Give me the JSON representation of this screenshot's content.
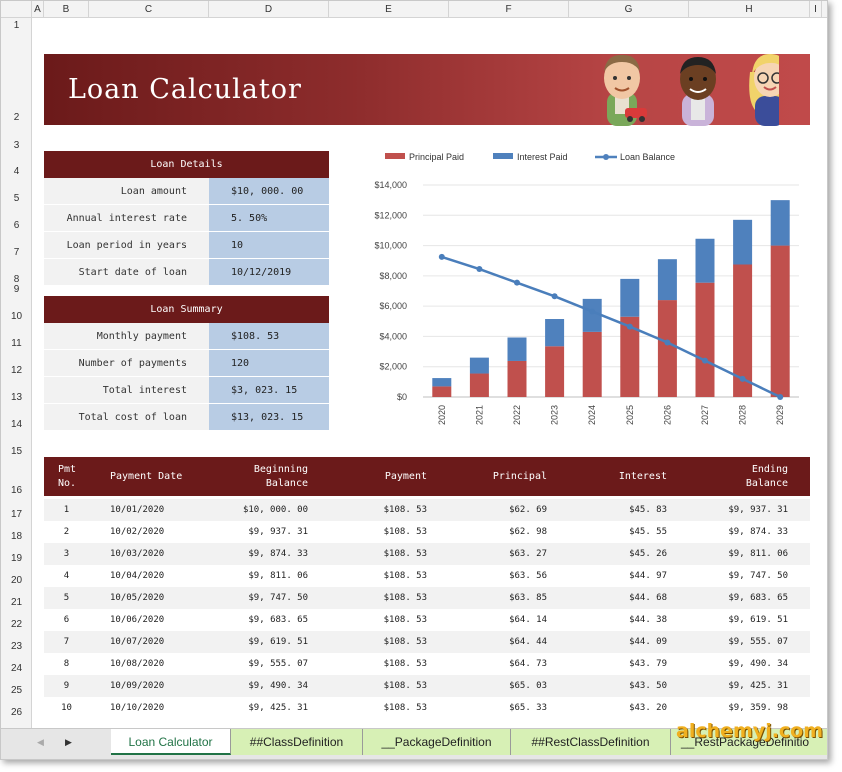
{
  "columns": [
    "A",
    "B",
    "C",
    "D",
    "E",
    "F",
    "G",
    "H",
    "I"
  ],
  "rows": [
    "1",
    "2",
    "3",
    "4",
    "5",
    "6",
    "7",
    "8",
    "9",
    "10",
    "11",
    "12",
    "13",
    "14",
    "15",
    "16",
    "17",
    "18",
    "19",
    "20",
    "21",
    "22",
    "23",
    "24",
    "25",
    "26"
  ],
  "banner": {
    "title": "Loan Calculator"
  },
  "loan_details": {
    "header": "Loan Details",
    "items": [
      {
        "label": "Loan amount",
        "value": "$10, 000. 00"
      },
      {
        "label": "Annual interest rate",
        "value": "5. 50%"
      },
      {
        "label": "Loan period in years",
        "value": "10"
      },
      {
        "label": "Start date of loan",
        "value": "10/12/2019"
      }
    ]
  },
  "loan_summary": {
    "header": "Loan Summary",
    "items": [
      {
        "label": "Monthly payment",
        "value": "$108. 53"
      },
      {
        "label": "Number of payments",
        "value": "120"
      },
      {
        "label": "Total interest",
        "value": "$3, 023. 15"
      },
      {
        "label": "Total cost of loan",
        "value": "$13, 023. 15"
      }
    ]
  },
  "chart_data": {
    "type": "bar",
    "stacked": true,
    "categories": [
      "2020",
      "2021",
      "2022",
      "2023",
      "2024",
      "2025",
      "2026",
      "2027",
      "2028",
      "2029"
    ],
    "series": [
      {
        "name": "Principal Paid",
        "color": "#c0504d",
        "values": [
          700,
          1550,
          2380,
          3350,
          4300,
          5300,
          6400,
          7550,
          8750,
          10000
        ]
      },
      {
        "name": "Interest Paid",
        "color": "#4f81bd",
        "values": [
          550,
          1050,
          1550,
          1800,
          2180,
          2500,
          2700,
          2900,
          2950,
          3000
        ]
      },
      {
        "name": "Loan Balance",
        "color": "#4f81bd",
        "type": "line",
        "values": [
          9250,
          8450,
          7550,
          6650,
          5650,
          4650,
          3600,
          2400,
          1200,
          0
        ]
      }
    ],
    "y_ticks": [
      "$0",
      "$2,000",
      "$4,000",
      "$6,000",
      "$8,000",
      "$10,000",
      "$12,000",
      "$14,000"
    ],
    "ylim": [
      0,
      14000
    ],
    "legend": "top",
    "grid": true
  },
  "table": {
    "headers": {
      "num": [
        "Pmt",
        "No."
      ],
      "date": "Payment Date",
      "begin": [
        "Beginning",
        "Balance"
      ],
      "payment": "Payment",
      "principal": "Principal",
      "interest": "Interest",
      "end": [
        "Ending",
        "Balance"
      ]
    },
    "rows": [
      [
        "1",
        "10/01/2020",
        "$10, 000. 00",
        "$108. 53",
        "$62. 69",
        "$45. 83",
        "$9, 937. 31"
      ],
      [
        "2",
        "10/02/2020",
        "$9, 937. 31",
        "$108. 53",
        "$62. 98",
        "$45. 55",
        "$9, 874. 33"
      ],
      [
        "3",
        "10/03/2020",
        "$9, 874. 33",
        "$108. 53",
        "$63. 27",
        "$45. 26",
        "$9, 811. 06"
      ],
      [
        "4",
        "10/04/2020",
        "$9, 811. 06",
        "$108. 53",
        "$63. 56",
        "$44. 97",
        "$9, 747. 50"
      ],
      [
        "5",
        "10/05/2020",
        "$9, 747. 50",
        "$108. 53",
        "$63. 85",
        "$44. 68",
        "$9, 683. 65"
      ],
      [
        "6",
        "10/06/2020",
        "$9, 683. 65",
        "$108. 53",
        "$64. 14",
        "$44. 38",
        "$9, 619. 51"
      ],
      [
        "7",
        "10/07/2020",
        "$9, 619. 51",
        "$108. 53",
        "$64. 44",
        "$44. 09",
        "$9, 555. 07"
      ],
      [
        "8",
        "10/08/2020",
        "$9, 555. 07",
        "$108. 53",
        "$64. 73",
        "$43. 79",
        "$9, 490. 34"
      ],
      [
        "9",
        "10/09/2020",
        "$9, 490. 34",
        "$108. 53",
        "$65. 03",
        "$43. 50",
        "$9, 425. 31"
      ],
      [
        "10",
        "10/10/2020",
        "$9, 425. 31",
        "$108. 53",
        "$65. 33",
        "$43. 20",
        "$9, 359. 98"
      ]
    ]
  },
  "tabs": [
    "Loan Calculator",
    "##ClassDefinition",
    "__PackageDefinition",
    "##RestClassDefinition",
    "__RestPackageDefinitio"
  ],
  "watermark": "alchemyj.com"
}
